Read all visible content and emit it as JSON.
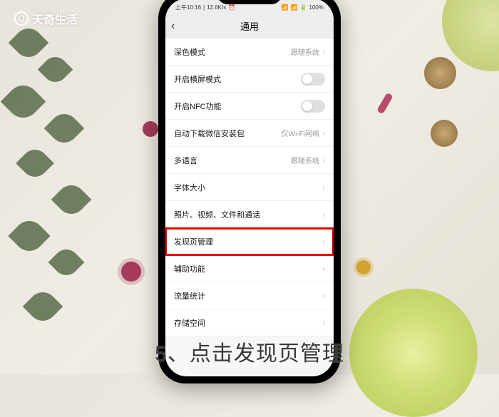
{
  "watermark": {
    "text": "天奇生活"
  },
  "statusbar": {
    "time": "上午10:16",
    "speed": "12.6K/s",
    "battery": "100%"
  },
  "navbar": {
    "title": "通用"
  },
  "rows": [
    {
      "label": "深色模式",
      "value": "跟随系统",
      "type": "link"
    },
    {
      "label": "开启横屏模式",
      "type": "toggle"
    },
    {
      "label": "开启NFC功能",
      "type": "toggle"
    },
    {
      "label": "自动下载微信安装包",
      "value": "仅Wi-Fi网络",
      "type": "link"
    },
    {
      "label": "多语言",
      "value": "跟随系统",
      "type": "link"
    },
    {
      "label": "字体大小",
      "type": "link"
    },
    {
      "label": "照片、视频、文件和通话",
      "type": "link"
    },
    {
      "label": "发现页管理",
      "type": "link",
      "highlight": true
    },
    {
      "label": "辅助功能",
      "type": "link"
    },
    {
      "label": "流量统计",
      "type": "link"
    },
    {
      "label": "存储空间",
      "type": "link"
    }
  ],
  "caption": "5、点击发现页管理"
}
